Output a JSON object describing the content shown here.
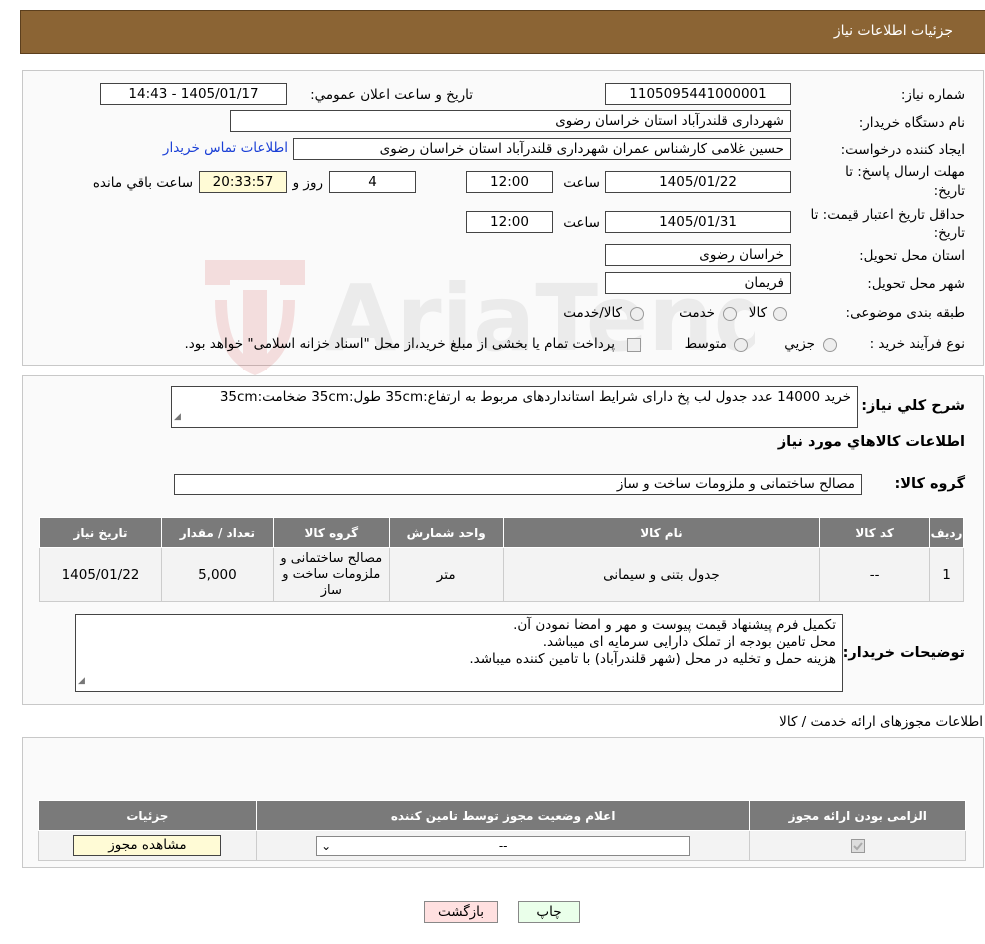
{
  "header": {
    "title": "جزئیات اطلاعات نیاز"
  },
  "form": {
    "need_number_label": "شماره نیاز:",
    "need_number": "1105095441000001",
    "announce_label": "تاريخ و ساعت اعلان عمومي:",
    "announce_value": "1405/01/17 - 14:43",
    "buyer_org_label": "نام دستگاه خريدار:",
    "buyer_org": "شهرداری قلندرآباد استان خراسان رضوی",
    "creator_label": "ايجاد کننده درخواست:",
    "creator": "حسین غلامی کارشناس عمران شهرداری قلندرآباد استان خراسان رضوی",
    "contact_link": "اطلاعات تماس خريدار",
    "deadline_label_1": "مهلت ارسال پاسخ: تا",
    "deadline_label_2": "تاريخ:",
    "deadline_date": "1405/01/22",
    "time_label": "ساعت",
    "deadline_time": "12:00",
    "days": "4",
    "days_label": "روز و",
    "remaining": "20:33:57",
    "remaining_label": "ساعت باقي مانده",
    "validity_label_1": "حداقل تاريخ اعتبار قيمت: تا",
    "validity_label_2": "تاريخ:",
    "validity_date": "1405/01/31",
    "validity_time": "12:00",
    "province_label": "استان محل تحويل:",
    "province": "خراسان رضوی",
    "city_label": "شهر محل تحويل:",
    "city": "فریمان",
    "category_label": "طبقه بندی موضوعی:",
    "cat_goods": "کالا",
    "cat_service": "خدمت",
    "cat_both": "کالا/خدمت",
    "process_label": "نوع فرآيند خريد :",
    "proc_partial": "جزيي",
    "proc_medium": "متوسط",
    "proc_note": "پرداخت تمام يا بخشی از مبلغ خريد،از محل \"اسناد خزانه اسلامی\" خواهد بود."
  },
  "details": {
    "desc_label": "شرح کلي نياز:",
    "desc": "خرید 14000 عدد جدول لب پخ دارای شرایط استانداردهای مربوط به ارتفاع:35cm طول:35cm ضخامت:35cm",
    "goods_info_title": "اطلاعات کالاهاي مورد نياز",
    "group_label": "گروه کالا:",
    "group": "مصالح ساختمانی و ملزومات ساخت و ساز",
    "table": {
      "headers": [
        "رديف",
        "کد کالا",
        "نام کالا",
        "واحد شمارش",
        "گروه کالا",
        "تعداد / مقدار",
        "تاريخ نياز"
      ],
      "row": [
        "1",
        "--",
        "جدول بتنی و سیمانی",
        "متر",
        "مصالح ساختمانی و ملزومات ساخت و ساز",
        "5,000",
        "1405/01/22"
      ]
    },
    "buyer_notes_label": "توضيحات خريدار:",
    "buyer_notes": [
      "تکمیل فرم پیشنهاد قیمت پیوست و مهر و امضا نمودن آن.",
      "محل تامین بودجه از تملک دارایی سرمایه ای میباشد.",
      "هزینه حمل و تخلیه در محل (شهر قلندرآباد) با تامین کننده میباشد."
    ]
  },
  "permits": {
    "title": "اطلاعات مجوزهای ارائه خدمت / کالا",
    "headers": [
      "الزامی بودن ارائه مجوز",
      "اعلام وضعیت مجوز توسط تامین کننده",
      "جزئیات"
    ],
    "select_value": "--",
    "view_button": "مشاهده مجوز"
  },
  "actions": {
    "print": "چاپ",
    "back": "بازگشت"
  },
  "watermark": {
    "text": "AriaTender.neT"
  }
}
